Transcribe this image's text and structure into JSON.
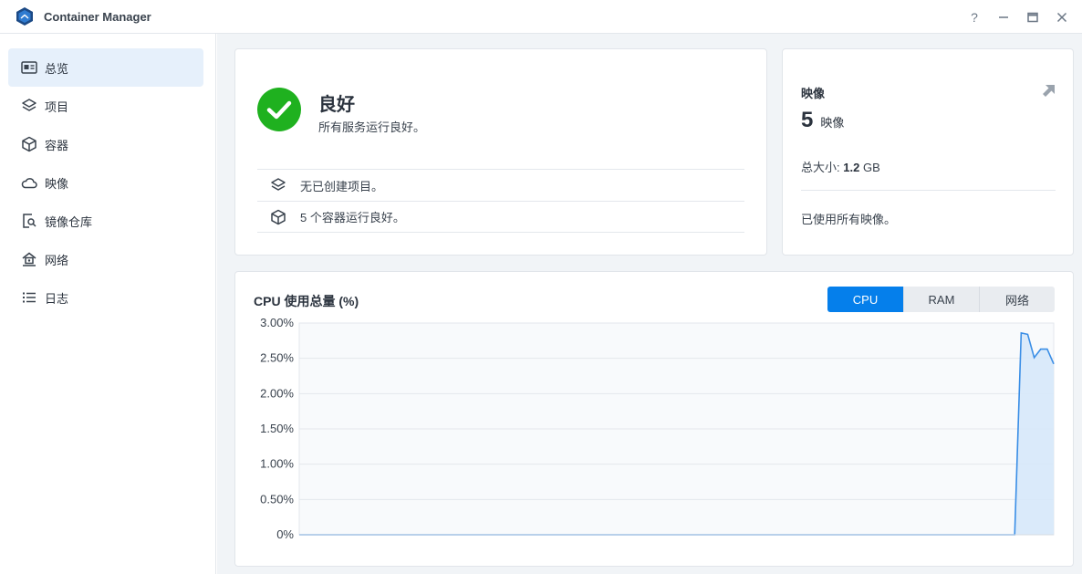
{
  "window": {
    "title": "Container Manager",
    "controls": [
      "?",
      "—",
      "□",
      "✕"
    ]
  },
  "sidebar": {
    "items": [
      {
        "label": "总览",
        "icon": "overview-icon",
        "active": true
      },
      {
        "label": "项目",
        "icon": "layers-icon",
        "active": false
      },
      {
        "label": "容器",
        "icon": "cube-icon",
        "active": false
      },
      {
        "label": "映像",
        "icon": "cloud-icon",
        "active": false
      },
      {
        "label": "镜像仓库",
        "icon": "registry-search-icon",
        "active": false
      },
      {
        "label": "网络",
        "icon": "network-home-icon",
        "active": false
      },
      {
        "label": "日志",
        "icon": "log-list-icon",
        "active": false
      }
    ]
  },
  "status": {
    "title": "良好",
    "subtitle": "所有服务运行良好。",
    "color": "#1fb11f",
    "rows": [
      {
        "icon": "layers-icon",
        "text": "无已创建项目。"
      },
      {
        "icon": "cube-icon",
        "text": "5 个容器运行良好。"
      }
    ]
  },
  "images": {
    "title": "映像",
    "count": "5",
    "count_label": "映像",
    "size_label": "总大小:",
    "size_value": "1.2",
    "size_unit": "GB",
    "note": "已使用所有映像。",
    "link_icon": "open-arrow-icon"
  },
  "chart_tabs": {
    "items": [
      "CPU",
      "RAM",
      "网络"
    ],
    "active": 0,
    "accent": "#057feb"
  },
  "chart_data": {
    "type": "area",
    "title": "CPU 使用总量 (%)",
    "xlabel": "",
    "ylabel": "",
    "ylim": [
      0,
      3
    ],
    "yticks": [
      "3.00%",
      "2.50%",
      "2.00%",
      "1.50%",
      "1.00%",
      "0.50%",
      "0%"
    ],
    "grid": true,
    "color": "#3a8ee6",
    "fill": "#d6e8fa",
    "series": [
      {
        "values": [
          0,
          0,
          0,
          0,
          0,
          0,
          0,
          0,
          0,
          0,
          0,
          0,
          0,
          0,
          0,
          0,
          0,
          0,
          0,
          0,
          0,
          0,
          0,
          0,
          0,
          0,
          0,
          0,
          0,
          0,
          0,
          0,
          0,
          0,
          0,
          0,
          0,
          0,
          0,
          0,
          0,
          0,
          0,
          0,
          0,
          0,
          0,
          0,
          0,
          0,
          0,
          0,
          0,
          0,
          0,
          0,
          0,
          0,
          0,
          0,
          0,
          0,
          0,
          0,
          0,
          0,
          0,
          0,
          0,
          0,
          0,
          0,
          0,
          0,
          0,
          0,
          0,
          0,
          0,
          0,
          0,
          0,
          0,
          0,
          0,
          0,
          0,
          0,
          0,
          0,
          0,
          0,
          0,
          0,
          0,
          0,
          0,
          0,
          0,
          0,
          0,
          0,
          0,
          0,
          0,
          0,
          0,
          0,
          0,
          0,
          0,
          2.86,
          2.84,
          2.51,
          2.63,
          2.63,
          2.42
        ]
      }
    ]
  }
}
